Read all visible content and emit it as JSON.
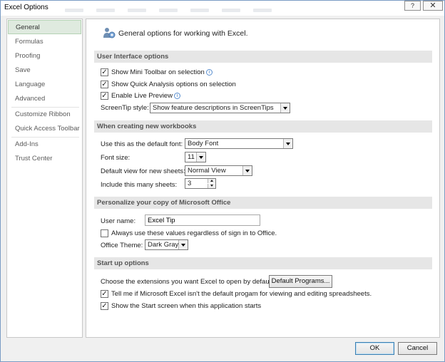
{
  "window": {
    "title": "Excel Options",
    "help_glyph": "?",
    "close_glyph": "✕"
  },
  "sidebar": {
    "items": [
      {
        "label": "General",
        "active": true
      },
      {
        "label": "Formulas"
      },
      {
        "label": "Proofing"
      },
      {
        "label": "Save"
      },
      {
        "label": "Language"
      },
      {
        "label": "Advanced"
      },
      {
        "label": "Customize Ribbon"
      },
      {
        "label": "Quick Access Toolbar"
      },
      {
        "label": "Add-Ins"
      },
      {
        "label": "Trust Center"
      }
    ]
  },
  "header": {
    "text": "General options for working with Excel.",
    "icon": "people-gear-icon"
  },
  "ui_options": {
    "title": "User Interface options",
    "mini_toolbar": {
      "label": "Show Mini Toolbar on selection",
      "checked": true
    },
    "quick_analysis": {
      "label": "Show Quick Analysis options on selection",
      "checked": true
    },
    "live_preview": {
      "label": "Enable Live Preview",
      "checked": true
    },
    "screentip": {
      "label": "ScreenTip style:",
      "value": "Show feature descriptions in ScreenTips"
    }
  },
  "new_workbooks": {
    "title": "When creating new workbooks",
    "font_label": "Use this as the default font:",
    "font_value": "Body Font",
    "size_label": "Font size:",
    "size_value": "11",
    "view_label": "Default view for new sheets:",
    "view_value": "Normal View",
    "sheets_label": "Include this many sheets:",
    "sheets_value": "3"
  },
  "personalize": {
    "title": "Personalize your copy of Microsoft Office",
    "username_label": "User name:",
    "username_value": "Excel Tip",
    "always_use": {
      "label": "Always use these values regardless of sign in to Office.",
      "checked": false
    },
    "theme_label": "Office Theme:",
    "theme_value": "Dark Gray"
  },
  "startup": {
    "title": "Start up options",
    "extensions_label": "Choose the extensions you want Excel to open by default:",
    "default_programs_button": "Default Programs...",
    "tell_me": {
      "label": "Tell me if Microsoft Excel isn't the default progam for viewing and editing spreadsheets.",
      "checked": true
    },
    "start_screen": {
      "label": "Show the Start screen when this application starts",
      "checked": true
    }
  },
  "footer": {
    "ok": "OK",
    "cancel": "Cancel"
  },
  "colors": {
    "active_nav_bg": "#dfeadf",
    "section_bg": "#e6e6e6",
    "info_blue": "#3c78c0"
  }
}
